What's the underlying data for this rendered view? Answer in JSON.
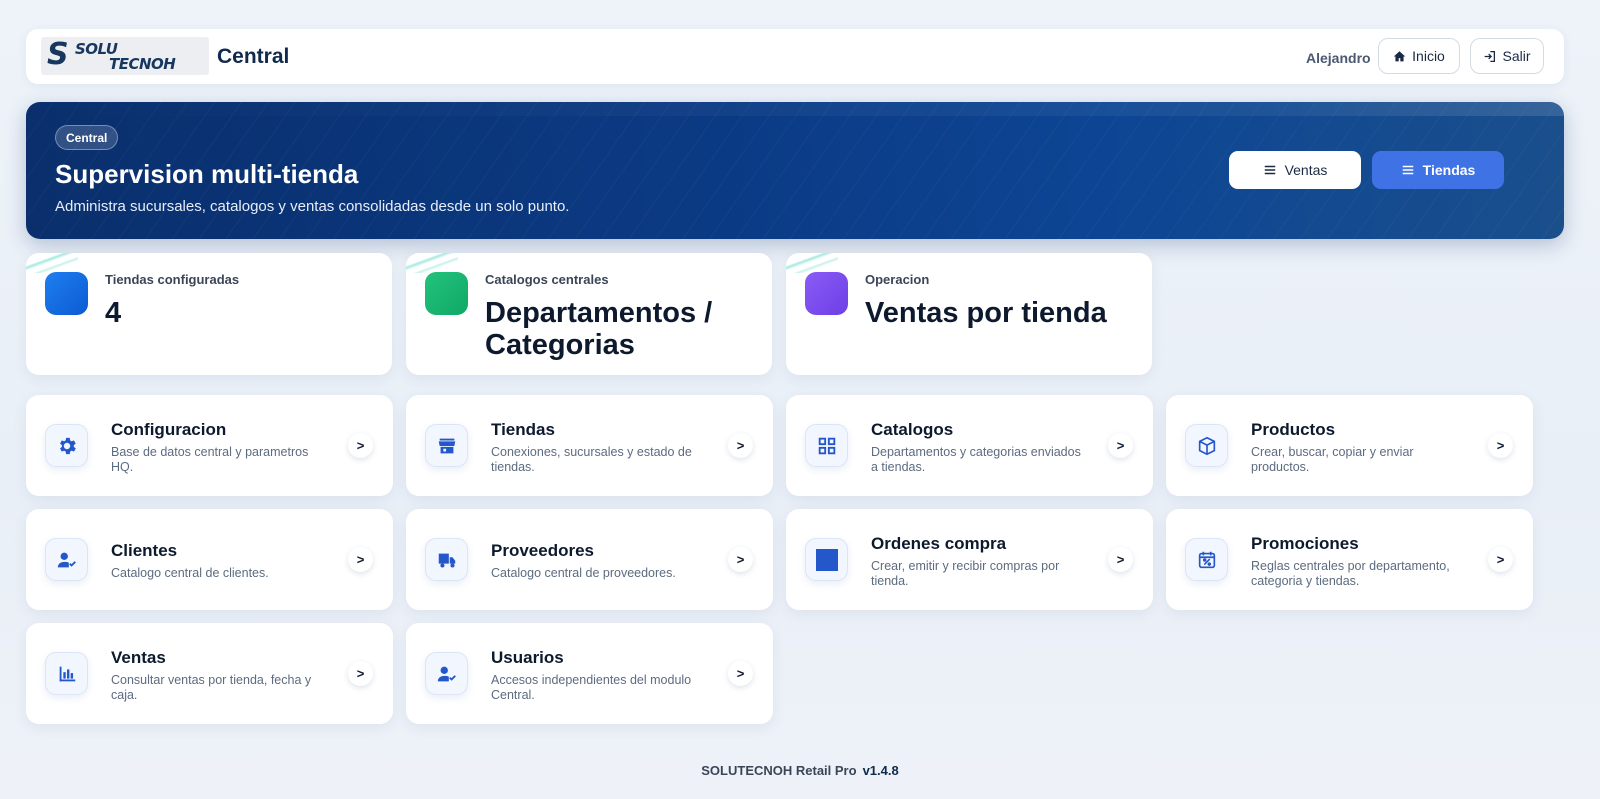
{
  "header": {
    "logo_text_top": "SOLU",
    "logo_text_bottom": "TECNOH",
    "title": "Central",
    "user": "Alejandro",
    "home_label": "Inicio",
    "logout_label": "Salir"
  },
  "hero": {
    "badge": "Central",
    "title": "Supervision multi-tienda",
    "subtitle": "Administra sucursales, catalogos y ventas consolidadas desde un solo punto.",
    "btn_ventas": "Ventas",
    "btn_tiendas": "Tiendas"
  },
  "stats": [
    {
      "label": "Tiendas configuradas",
      "value": "4",
      "icon": "store-count-icon",
      "color": "#1a74e8"
    },
    {
      "label": "Catalogos centrales",
      "value": "Departamentos / Categorias",
      "icon": "catalog-icon",
      "color": "#1cb870"
    },
    {
      "label": "Operacion",
      "value": "Ventas por tienda",
      "icon": "operation-icon",
      "color": "#7b4ff0"
    }
  ],
  "modules": [
    {
      "title": "Configuracion",
      "desc": "Base de datos central y parametros HQ.",
      "icon": "gear-icon"
    },
    {
      "title": "Tiendas",
      "desc": "Conexiones, sucursales y estado de tiendas.",
      "icon": "store-icon"
    },
    {
      "title": "Catalogos",
      "desc": "Departamentos y categorias enviados a tiendas.",
      "icon": "grid-icon"
    },
    {
      "title": "Productos",
      "desc": "Crear, buscar, copiar y enviar productos.",
      "icon": "box-icon"
    },
    {
      "title": "Clientes",
      "desc": "Catalogo central de clientes.",
      "icon": "user-check-icon"
    },
    {
      "title": "Proveedores",
      "desc": "Catalogo central de proveedores.",
      "icon": "truck-icon"
    },
    {
      "title": "Ordenes compra",
      "desc": "Crear, emitir y recibir compras por tienda.",
      "icon": "square-icon"
    },
    {
      "title": "Promociones",
      "desc": "Reglas centrales por departamento, categoria y tiendas.",
      "icon": "calendar-percent-icon"
    },
    {
      "title": "Ventas",
      "desc": "Consultar ventas por tienda, fecha y caja.",
      "icon": "bar-chart-icon"
    },
    {
      "title": "Usuarios",
      "desc": "Accesos independientes del modulo Central.",
      "icon": "user-check-icon"
    }
  ],
  "arrow": ">",
  "footer": {
    "product": "SOLUTECNOH Retail Pro",
    "version": "v1.4.8"
  },
  "colors": {
    "accent": "#3f72e4",
    "hero": "#0b3a84",
    "icon": "#2457c9"
  }
}
